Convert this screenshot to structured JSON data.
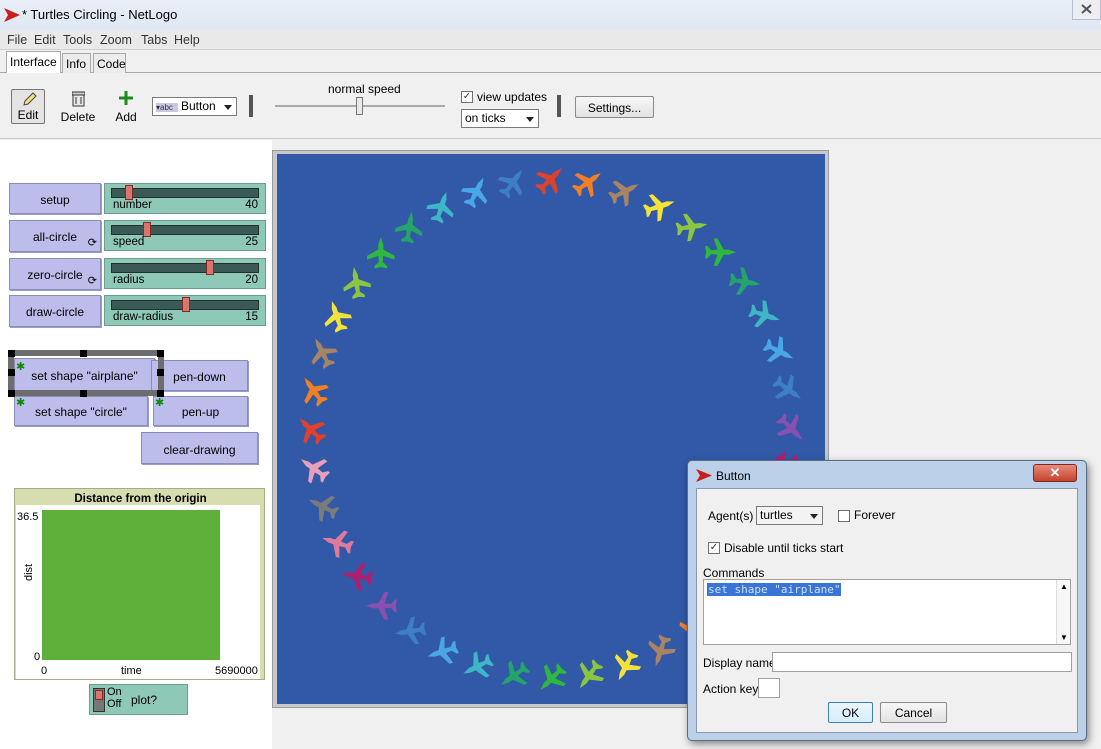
{
  "window": {
    "title": "* Turtles Circling - NetLogo"
  },
  "menu": [
    "File",
    "Edit",
    "Tools",
    "Zoom",
    "Tabs",
    "Help"
  ],
  "tabs": [
    "Interface",
    "Info",
    "Code"
  ],
  "toolbar": {
    "edit_label": "Edit",
    "delete_label": "Delete",
    "add_label": "Add",
    "widget_type": "Button",
    "speed_label": "normal speed",
    "view_updates_label": "view updates",
    "view_updates_checked": true,
    "update_mode": "on ticks",
    "settings_label": "Settings..."
  },
  "buttons": {
    "setup": "setup",
    "all_circle": "all-circle",
    "zero_circle": "zero-circle",
    "draw_circle": "draw-circle",
    "set_shape_airplane": "set shape \"airplane\"",
    "pen_down": "pen-down",
    "set_shape_circle": "set shape \"circle\"",
    "pen_up": "pen-up",
    "clear_drawing": "clear-drawing"
  },
  "sliders": [
    {
      "name": "number",
      "value": "40",
      "fraction": 0.1
    },
    {
      "name": "speed",
      "value": "25",
      "fraction": 0.24
    },
    {
      "name": "radius",
      "value": "20",
      "fraction": 0.67
    },
    {
      "name": "draw-radius",
      "value": "15",
      "fraction": 0.52
    }
  ],
  "plot": {
    "title": "Distance from the origin",
    "ylabel": "dist",
    "xlabel": "time",
    "ymax": "36.5",
    "ymin": "0",
    "xmin": "0",
    "xmax": "5690000",
    "fill_color": "#5db03a"
  },
  "switch": {
    "on": "On",
    "off": "Off",
    "label": "plot?"
  },
  "world": {
    "background": "#3159a8",
    "turtle_colors": [
      "#e0412b",
      "#f07f26",
      "#a88462",
      "#f2e23a",
      "#8cc63f",
      "#2fb83e",
      "#24a36b",
      "#3fb6c6",
      "#49a7e8",
      "#3d7ec4",
      "#8a50b0",
      "#b01f6e",
      "#e07a9c",
      "#7b7b7b",
      "#e8a0b8"
    ]
  },
  "dialog": {
    "title": "Button",
    "agents_label": "Agent(s)",
    "agents_value": "turtles",
    "forever_label": "Forever",
    "forever_checked": false,
    "disable_label": "Disable until ticks start",
    "disable_checked": true,
    "commands_label": "Commands",
    "commands_text": "set shape \"airplane\"",
    "display_name_label": "Display name",
    "display_name_value": "",
    "action_key_label": "Action key",
    "action_key_value": "",
    "ok_label": "OK",
    "cancel_label": "Cancel"
  }
}
